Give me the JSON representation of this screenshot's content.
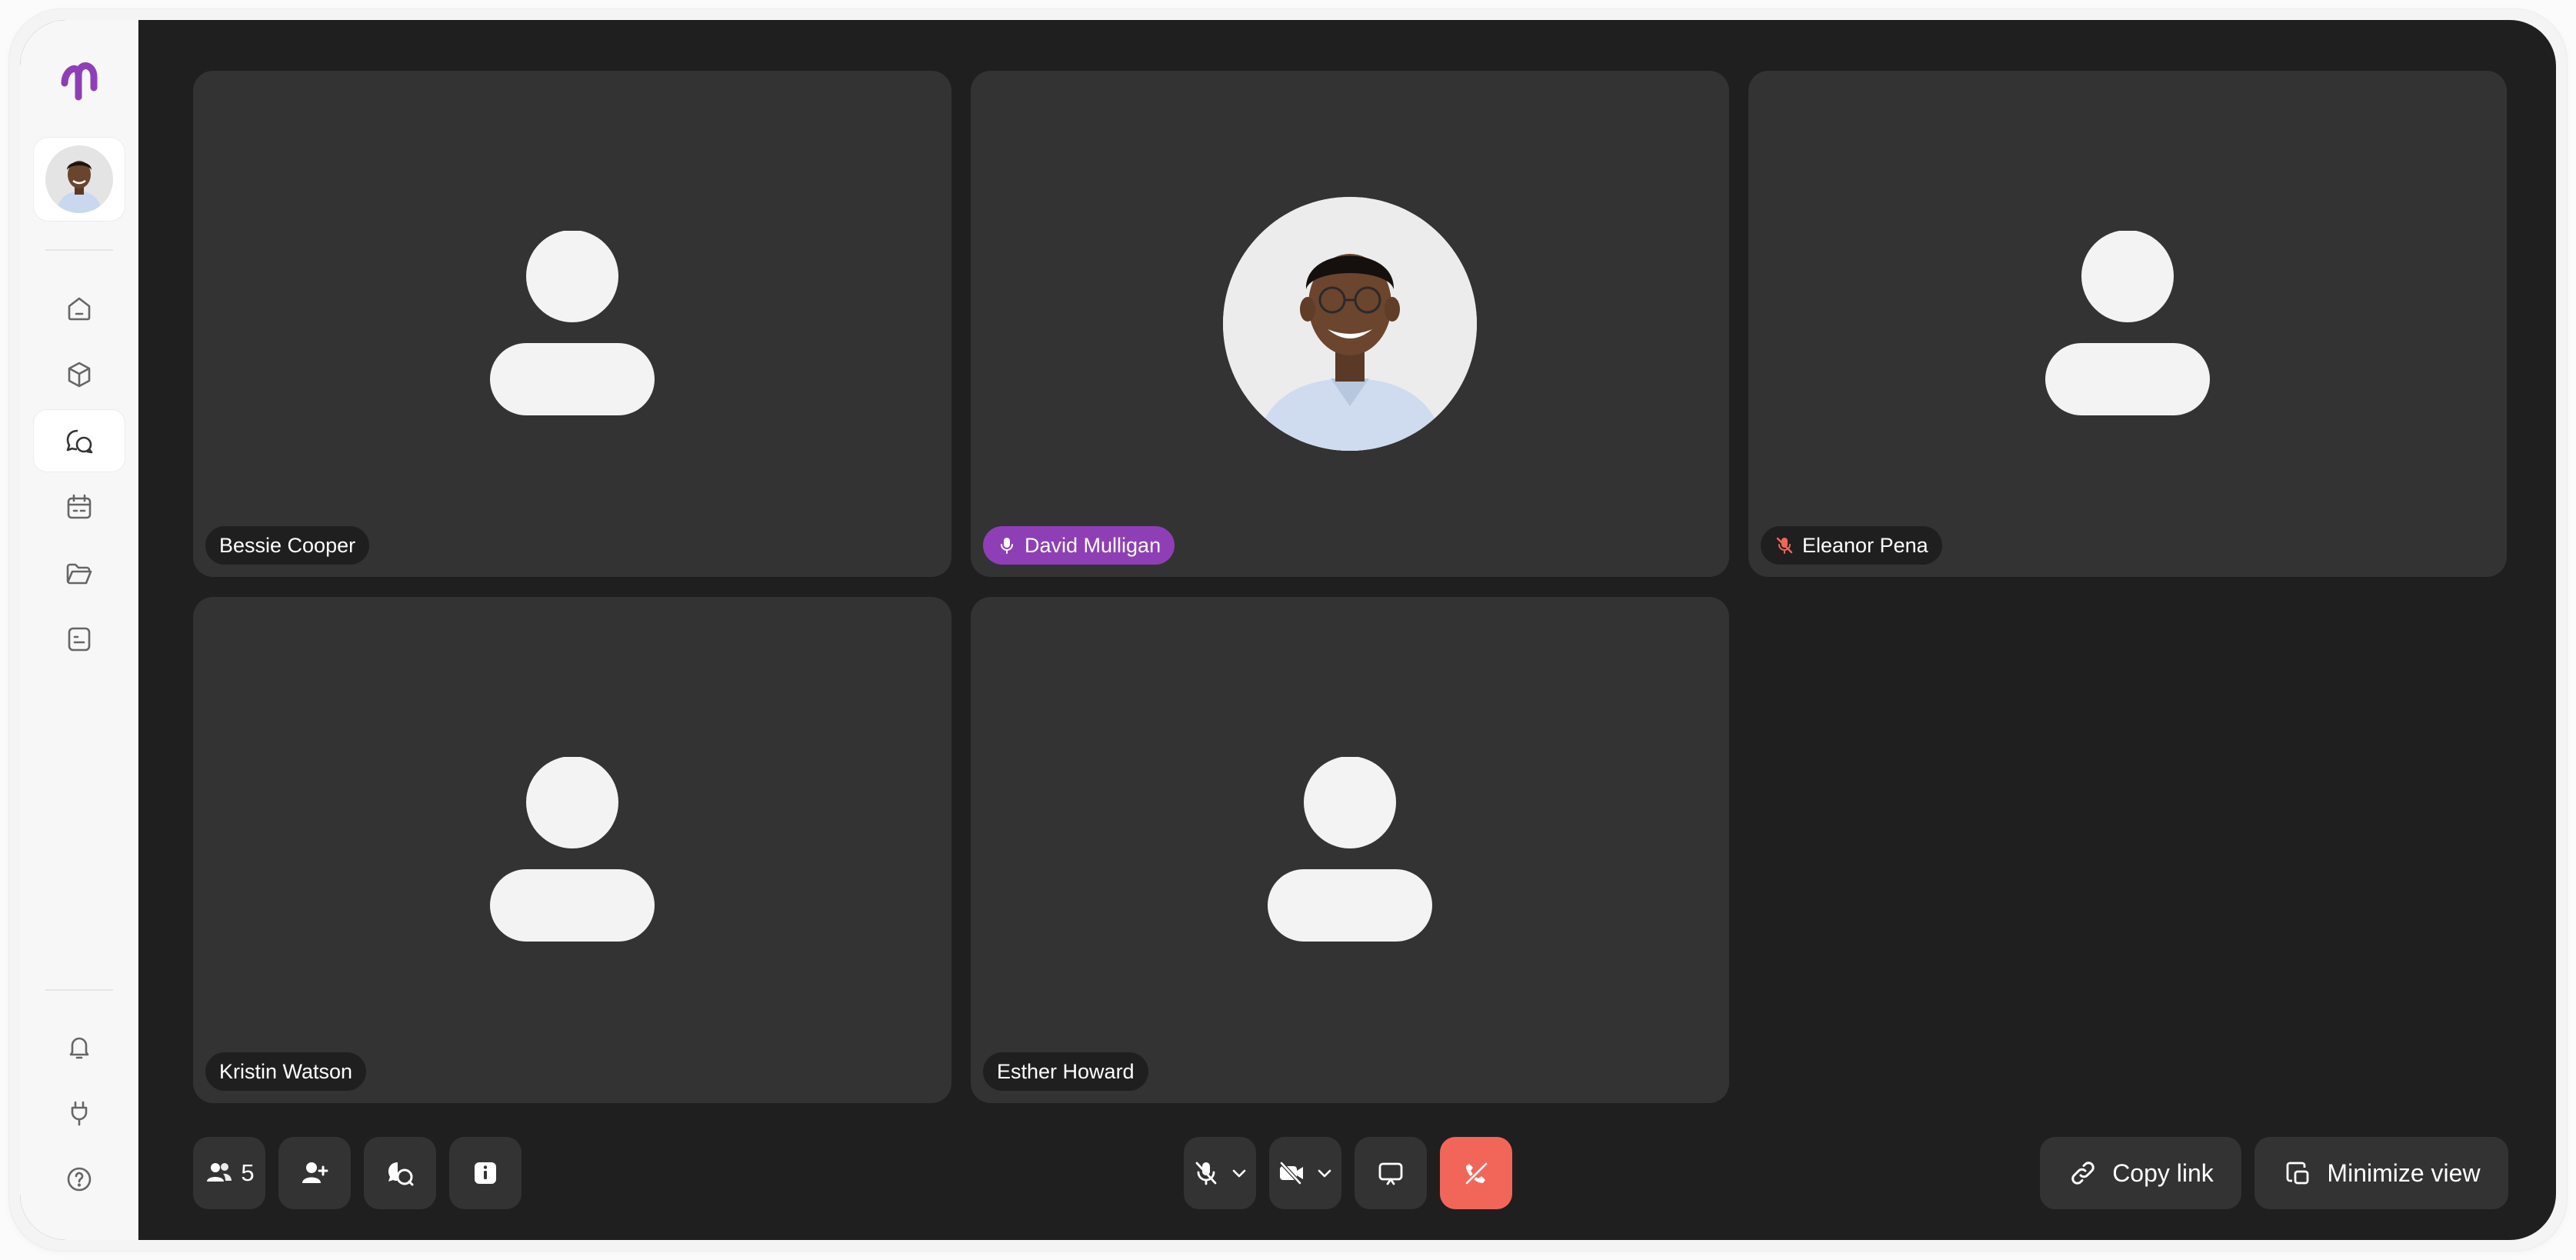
{
  "app": {
    "logo": "brand-logo"
  },
  "sidebar": {
    "items": [
      {
        "name": "home",
        "icon": "home-icon"
      },
      {
        "name": "box",
        "icon": "cube-icon"
      },
      {
        "name": "calls",
        "icon": "chat-bubbles-icon",
        "active": true
      },
      {
        "name": "calendar",
        "icon": "calendar-icon"
      },
      {
        "name": "files",
        "icon": "folder-icon"
      },
      {
        "name": "notes",
        "icon": "document-icon"
      }
    ],
    "bottom_items": [
      {
        "name": "notifications",
        "icon": "bell-icon"
      },
      {
        "name": "integrations",
        "icon": "plug-icon"
      },
      {
        "name": "help",
        "icon": "help-circle-icon"
      }
    ]
  },
  "participants": [
    {
      "name": "Bessie Cooper",
      "status": "none",
      "has_photo": false
    },
    {
      "name": "David Mulligan",
      "status": "speaking",
      "has_photo": true
    },
    {
      "name": "Eleanor Pena",
      "status": "muted",
      "has_photo": false
    },
    {
      "name": "Kristin Watson",
      "status": "none",
      "has_photo": false
    },
    {
      "name": "Esther Howard",
      "status": "none",
      "has_photo": false
    }
  ],
  "controls": {
    "participants_count": "5",
    "copy_link_label": "Copy link",
    "minimize_label": "Minimize view"
  },
  "colors": {
    "accent": "#8f3fb5",
    "end_call": "#f2665a",
    "muted_icon": "#f2665a",
    "tile_bg": "#333333",
    "stage_bg": "#1f1f1f"
  }
}
